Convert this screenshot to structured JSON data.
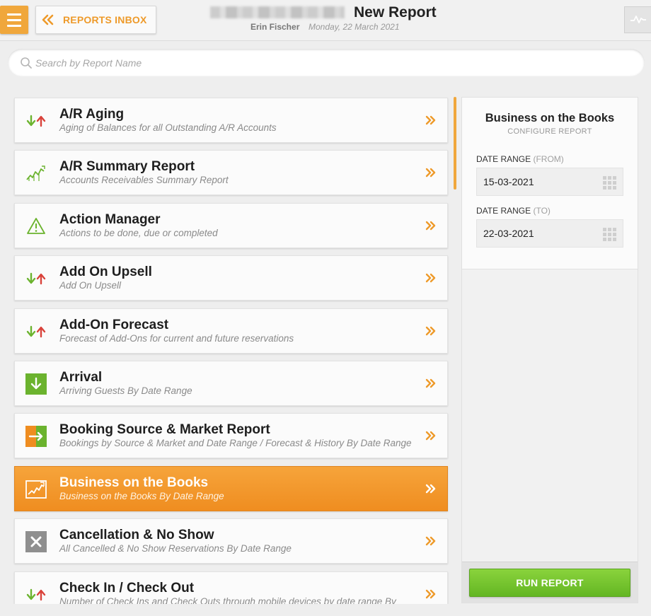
{
  "header": {
    "menu_icon": "hamburger-icon",
    "inbox_label": "REPORTS INBOX",
    "title": "New Report",
    "user": "Erin Fischer",
    "date": "Monday, 22 March 2021",
    "activity_icon": "activity-icon"
  },
  "search": {
    "placeholder": "Search by Report Name",
    "value": ""
  },
  "colors": {
    "accent": "#f0a73c",
    "active_item": "#f29a2e",
    "run_button": "#76c530",
    "arrow_up": "#d9423a",
    "arrow_down": "#6bb32e"
  },
  "reports": [
    {
      "name": "A/R Aging",
      "description": "Aging of Balances for all Outstanding A/R Accounts",
      "icon": "up-down-arrows-icon",
      "active": false
    },
    {
      "name": "A/R Summary Report",
      "description": "Accounts Receivables Summary Report",
      "icon": "trend-chart-icon",
      "active": false
    },
    {
      "name": "Action Manager",
      "description": "Actions to be done, due or completed",
      "icon": "warning-triangle-icon",
      "active": false
    },
    {
      "name": "Add On Upsell",
      "description": "Add On Upsell",
      "icon": "up-down-arrows-icon",
      "active": false
    },
    {
      "name": "Add-On Forecast",
      "description": "Forecast of Add-Ons for current and future reservations",
      "icon": "up-down-arrows-icon",
      "active": false
    },
    {
      "name": "Arrival",
      "description": "Arriving Guests By Date Range",
      "icon": "arrival-icon",
      "active": false
    },
    {
      "name": "Booking Source & Market Report",
      "description": "Bookings by Source & Market and Date Range / Forecast & History By Date Range",
      "icon": "booking-source-icon",
      "active": false
    },
    {
      "name": "Business on the Books",
      "description": "Business on the Books By Date Range",
      "icon": "trend-chart-icon",
      "active": true
    },
    {
      "name": "Cancellation & No Show",
      "description": "All Cancelled & No Show Reservations By Date Range",
      "icon": "cancel-icon",
      "active": false
    },
    {
      "name": "Check In / Check Out",
      "description": "Number of Check Ins and Check Outs through mobile devices by date range By",
      "icon": "up-down-arrows-icon",
      "active": false
    }
  ],
  "config": {
    "title": "Business on the Books",
    "subtitle": "CONFIGURE REPORT",
    "from_label": "DATE RANGE",
    "from_paren": "(FROM)",
    "from_value": "15-03-2021",
    "to_label": "DATE RANGE",
    "to_paren": "(TO)",
    "to_value": "22-03-2021",
    "calendar_icon": "calendar-grid-icon",
    "run_label": "RUN REPORT"
  }
}
